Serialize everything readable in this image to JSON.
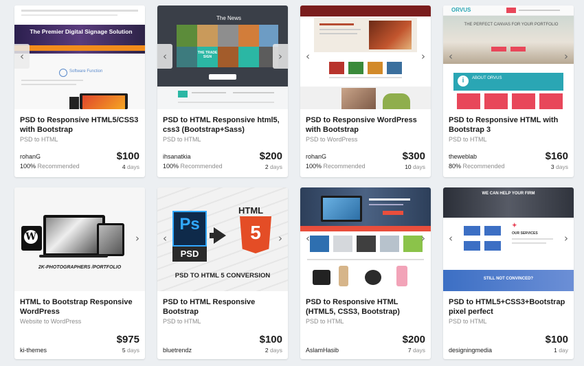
{
  "cards": [
    {
      "title": "PSD to Responsive HTML5/CSS3 with Bootstrap",
      "category": "PSD to HTML",
      "seller": "rohanG",
      "rating_pct": "100%",
      "rating_label": "Recommended",
      "price": "$100",
      "days_num": "4",
      "days_label": "days",
      "thumb": {
        "headline": "The Premier Digital Signage Solution",
        "sub": "Software Function"
      }
    },
    {
      "title": "PSD to HTML Responsive html5, css3 (Bootstrap+Sass)",
      "category": "PSD to HTML",
      "seller": "ihsanatkia",
      "rating_pct": "100%",
      "rating_label": "Recommended",
      "price": "$200",
      "days_num": "2",
      "days_label": "days",
      "thumb": {
        "header": "The News",
        "tile": "THE TRADE SIGN"
      }
    },
    {
      "title": "PSD to Responsive WordPress with Bootstrap",
      "category": "PSD to WordPress",
      "seller": "rohanG",
      "rating_pct": "100%",
      "rating_label": "Recommended",
      "price": "$300",
      "days_num": "10",
      "days_label": "days",
      "thumb": {}
    },
    {
      "title": "PSD to Responsive HTML with Bootstrap 3",
      "category": "PSD to HTML",
      "seller": "theweblab",
      "rating_pct": "80%",
      "rating_label": "Recommended",
      "price": "$160",
      "days_num": "3",
      "days_label": "days",
      "thumb": {
        "logo": "ORVUS",
        "headline": "THE PERFECT CANVAS FOR YOUR PORTFOLIO",
        "about": "ABOUT ORVUS"
      }
    },
    {
      "title": "HTML to Bootstrap Responsive WordPress",
      "category": "Website to WordPress",
      "seller": "ki-themes",
      "price": "$975",
      "days_num": "5",
      "days_label": "days",
      "thumb": {
        "caption": "2K-PHOTOGRAPHERS /PORTFOLIO"
      }
    },
    {
      "title": "PSD to HTML Responsive Bootstrap",
      "category": "PSD to HTML",
      "seller": "bluetrendz",
      "price": "$100",
      "days_num": "2",
      "days_label": "days",
      "thumb": {
        "ps": "Ps",
        "psd": "PSD",
        "html": "HTML",
        "five": "5",
        "caption": "PSD TO HTML 5 CONVERSION"
      }
    },
    {
      "title": "PSD to Responsive HTML (HTML5, CSS3, Bootstrap)",
      "category": "PSD to HTML",
      "seller": "AslamHasib",
      "price": "$200",
      "days_num": "7",
      "days_label": "days",
      "thumb": {}
    },
    {
      "title": "PSD to HTML5+CSS3+Bootstrap pixel perfect",
      "category": "PSD to HTML",
      "seller": "designingmedia",
      "price": "$100",
      "days_num": "1",
      "days_label": "day",
      "thumb": {
        "headline": "WE CAN HELP YOUR FIRM",
        "services": "OUR SERVICES",
        "cta": "STILL NOT CONVINCED?"
      }
    }
  ]
}
